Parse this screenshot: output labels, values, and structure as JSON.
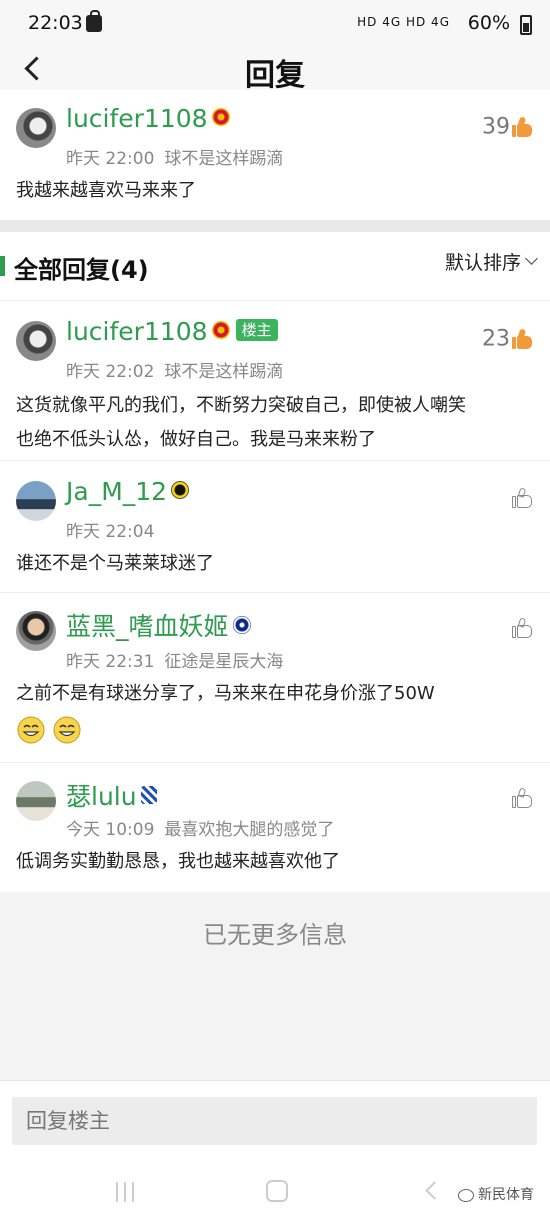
{
  "status_bar": {
    "time": "22:03",
    "network": "HD 4G HD 4G",
    "battery": "60%"
  },
  "header": {
    "title": "回复"
  },
  "original_post": {
    "username": "lucifer1108",
    "badge_icon": "manchester-united-badge-icon",
    "likes": "39",
    "date": "昨天 22:00",
    "signature": "球不是这样踢滴",
    "content": "我越来越喜欢马来来了"
  },
  "replies_section": {
    "title": "全部回复(4)",
    "sort_label": "默认排序"
  },
  "replies": [
    {
      "username": "lucifer1108",
      "badge_icon": "manchester-united-badge-icon",
      "host_tag": "楼主",
      "likes": "23",
      "date": "昨天 22:02",
      "signature": "球不是这样踢滴",
      "content_line1": "这货就像平凡的我们，不断努力突破自己，即使被人嘲笑",
      "content_line2": "也绝不低头认怂，做好自己。我是马来来粉了"
    },
    {
      "username": "Ja_M_12",
      "badge_icon": "borussia-dortmund-badge-icon",
      "date": "昨天 22:04",
      "content": "谁还不是个马莱莱球迷了"
    },
    {
      "username": "蓝黑_嗜血妖姬",
      "badge_icon": "inter-milan-badge-icon",
      "date": "昨天 22:31",
      "signature": "征途是星辰大海",
      "content": "之前不是有球迷分享了，马来来在申花身价涨了50W"
    },
    {
      "username": "瑟lulu",
      "badge_icon": "shanghai-shenhua-badge-icon",
      "date": "今天 10:09",
      "signature": "最喜欢抱大腿的感觉了",
      "content": "低调务实勤勤恳恳，我也越来越喜欢他了"
    }
  ],
  "end_note": "已无更多信息",
  "reply_box": {
    "placeholder": "回复楼主"
  },
  "watermark": "新民体育",
  "colors": {
    "accent_green": "#2e9c4e",
    "like_orange": "#f29a38",
    "host_tag_bg": "#3cb35f"
  }
}
